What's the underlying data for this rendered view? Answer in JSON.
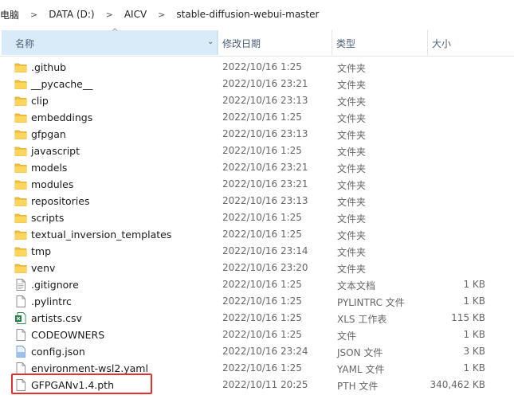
{
  "breadcrumb": [
    "电脑",
    "DATA (D:)",
    "AICV",
    "stable-diffusion-webui-master"
  ],
  "columns": {
    "name": "名称",
    "date": "修改日期",
    "type": "类型",
    "size": "大小"
  },
  "files": [
    {
      "name": ".github",
      "date": "2022/10/16 1:25",
      "type": "文件夹",
      "size": "",
      "icon": "folder-icon"
    },
    {
      "name": "__pycache__",
      "date": "2022/10/16 23:21",
      "type": "文件夹",
      "size": "",
      "icon": "folder-icon"
    },
    {
      "name": "clip",
      "date": "2022/10/16 23:13",
      "type": "文件夹",
      "size": "",
      "icon": "folder-icon"
    },
    {
      "name": "embeddings",
      "date": "2022/10/16 1:25",
      "type": "文件夹",
      "size": "",
      "icon": "folder-icon"
    },
    {
      "name": "gfpgan",
      "date": "2022/10/16 23:13",
      "type": "文件夹",
      "size": "",
      "icon": "folder-icon"
    },
    {
      "name": "javascript",
      "date": "2022/10/16 1:25",
      "type": "文件夹",
      "size": "",
      "icon": "folder-icon"
    },
    {
      "name": "models",
      "date": "2022/10/16 23:21",
      "type": "文件夹",
      "size": "",
      "icon": "folder-icon"
    },
    {
      "name": "modules",
      "date": "2022/10/16 23:21",
      "type": "文件夹",
      "size": "",
      "icon": "folder-icon"
    },
    {
      "name": "repositories",
      "date": "2022/10/16 23:13",
      "type": "文件夹",
      "size": "",
      "icon": "folder-icon"
    },
    {
      "name": "scripts",
      "date": "2022/10/16 1:25",
      "type": "文件夹",
      "size": "",
      "icon": "folder-icon"
    },
    {
      "name": "textual_inversion_templates",
      "date": "2022/10/16 1:25",
      "type": "文件夹",
      "size": "",
      "icon": "folder-icon"
    },
    {
      "name": "tmp",
      "date": "2022/10/16 23:14",
      "type": "文件夹",
      "size": "",
      "icon": "folder-icon"
    },
    {
      "name": "venv",
      "date": "2022/10/16 23:20",
      "type": "文件夹",
      "size": "",
      "icon": "folder-icon"
    },
    {
      "name": ".gitignore",
      "date": "2022/10/16 1:25",
      "type": "文本文档",
      "size": "1 KB",
      "icon": "text-file-icon"
    },
    {
      "name": ".pylintrc",
      "date": "2022/10/16 1:25",
      "type": "PYLINTRC 文件",
      "size": "1 KB",
      "icon": "file-icon"
    },
    {
      "name": "artists.csv",
      "date": "2022/10/16 1:25",
      "type": "XLS 工作表",
      "size": "115 KB",
      "icon": "spreadsheet-icon"
    },
    {
      "name": "CODEOWNERS",
      "date": "2022/10/16 1:25",
      "type": "文件",
      "size": "1 KB",
      "icon": "file-icon"
    },
    {
      "name": "config.json",
      "date": "2022/10/16 23:24",
      "type": "JSON 文件",
      "size": "3 KB",
      "icon": "json-file-icon"
    },
    {
      "name": "environment-wsl2.yaml",
      "date": "2022/10/16 1:25",
      "type": "YAML 文件",
      "size": "1 KB",
      "icon": "file-icon"
    },
    {
      "name": "GFPGANv1.4.pth",
      "date": "2022/10/11 20:25",
      "type": "PTH 文件",
      "size": "340,462 KB",
      "icon": "file-icon"
    }
  ]
}
